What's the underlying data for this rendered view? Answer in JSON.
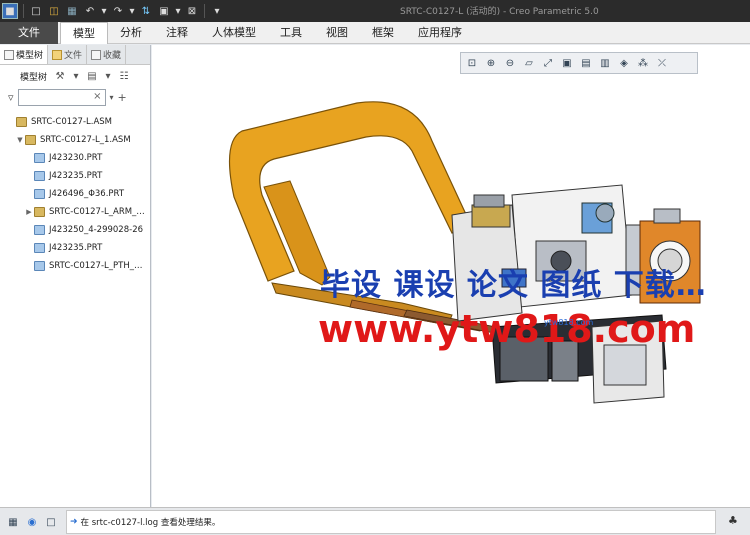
{
  "app": {
    "title": "SRTC-C0127-L (活动的) - Creo Parametric 5.0"
  },
  "quick_access": [
    "app-menu-icon",
    "new-icon",
    "open-icon",
    "save-icon",
    "undo-icon",
    "redo-icon",
    "regenerate-icon",
    "windows-icon",
    "close-window-icon",
    "customize-icon"
  ],
  "ribbon": {
    "tabs": [
      {
        "label": "文件"
      },
      {
        "label": "模型"
      },
      {
        "label": "分析"
      },
      {
        "label": "注释"
      },
      {
        "label": "人体模型"
      },
      {
        "label": "工具"
      },
      {
        "label": "视图"
      },
      {
        "label": "框架"
      },
      {
        "label": "应用程序"
      }
    ],
    "active_tab": "模型"
  },
  "left_panel": {
    "tabs": [
      {
        "label": "模型树"
      },
      {
        "label": "文件"
      },
      {
        "label": "收藏"
      }
    ],
    "toolbar_label": "模型树",
    "search_placeholder": "",
    "tree": [
      {
        "label": "SRTC-C0127-L.ASM",
        "type": "asm",
        "indent": 0,
        "expander": ""
      },
      {
        "label": "SRTC-C0127-L_1.ASM",
        "type": "asm",
        "indent": 1,
        "expander": "▼"
      },
      {
        "label": "J423230.PRT",
        "type": "prt",
        "indent": 2,
        "expander": ""
      },
      {
        "label": "J423235.PRT",
        "type": "prt",
        "indent": 2,
        "expander": ""
      },
      {
        "label": "J426496_Φ36.PRT",
        "type": "prt",
        "indent": 2,
        "expander": ""
      },
      {
        "label": "SRTC-C0127-L_ARM_…",
        "type": "asm",
        "indent": 2,
        "expander": "▶"
      },
      {
        "label": "J423250_4-299028-26",
        "type": "prt",
        "indent": 2,
        "expander": ""
      },
      {
        "label": "J423235.PRT",
        "type": "prt",
        "indent": 2,
        "expander": ""
      },
      {
        "label": "SRTC-C0127-L_PTH_…",
        "type": "prt",
        "indent": 2,
        "expander": ""
      }
    ]
  },
  "view_toolbar": [
    "refit-icon",
    "zoom-in-icon",
    "zoom-out-icon",
    "repaint-icon",
    "orient-icon",
    "display-style-icon",
    "saved-views-icon",
    "view-manager-icon",
    "perspective-icon",
    "datum-display-icon",
    "annotation-display-icon"
  ],
  "status": {
    "message": "在 srtc-c0127-l.log 查看处理结果。"
  },
  "watermark": {
    "line1": "毕设 课设 论文 图纸 下载…",
    "line2": "www.ytw818.com",
    "small": "ytw818.com"
  },
  "colors": {
    "frame_orange": "#e8a320",
    "model_gray": "#c9ccd1",
    "accent_blue": "#2b6fd0"
  }
}
